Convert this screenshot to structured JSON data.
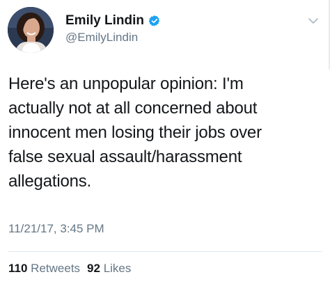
{
  "author": {
    "display_name": "Emily Lindin",
    "handle": "@EmilyLindin",
    "verified": true,
    "avatar_icon": "profile-photo",
    "verified_icon": "verified-badge-icon",
    "verified_color": "#1da1f2"
  },
  "menu": {
    "caret_icon": "chevron-down-icon"
  },
  "tweet": {
    "text": "Here's an unpopular opinion: I'm\nactually not at all concerned about\ninnocent men losing their jobs over\nfalse sexual assault/harassment\nallegations.",
    "timestamp": "11/21/17, 3:45 PM"
  },
  "stats": {
    "retweets_count": "110",
    "retweets_label": "Retweets",
    "likes_count": "92",
    "likes_label": "Likes"
  },
  "colors": {
    "text_primary": "#14171a",
    "text_secondary": "#657786",
    "divider": "#e1e8ed"
  }
}
